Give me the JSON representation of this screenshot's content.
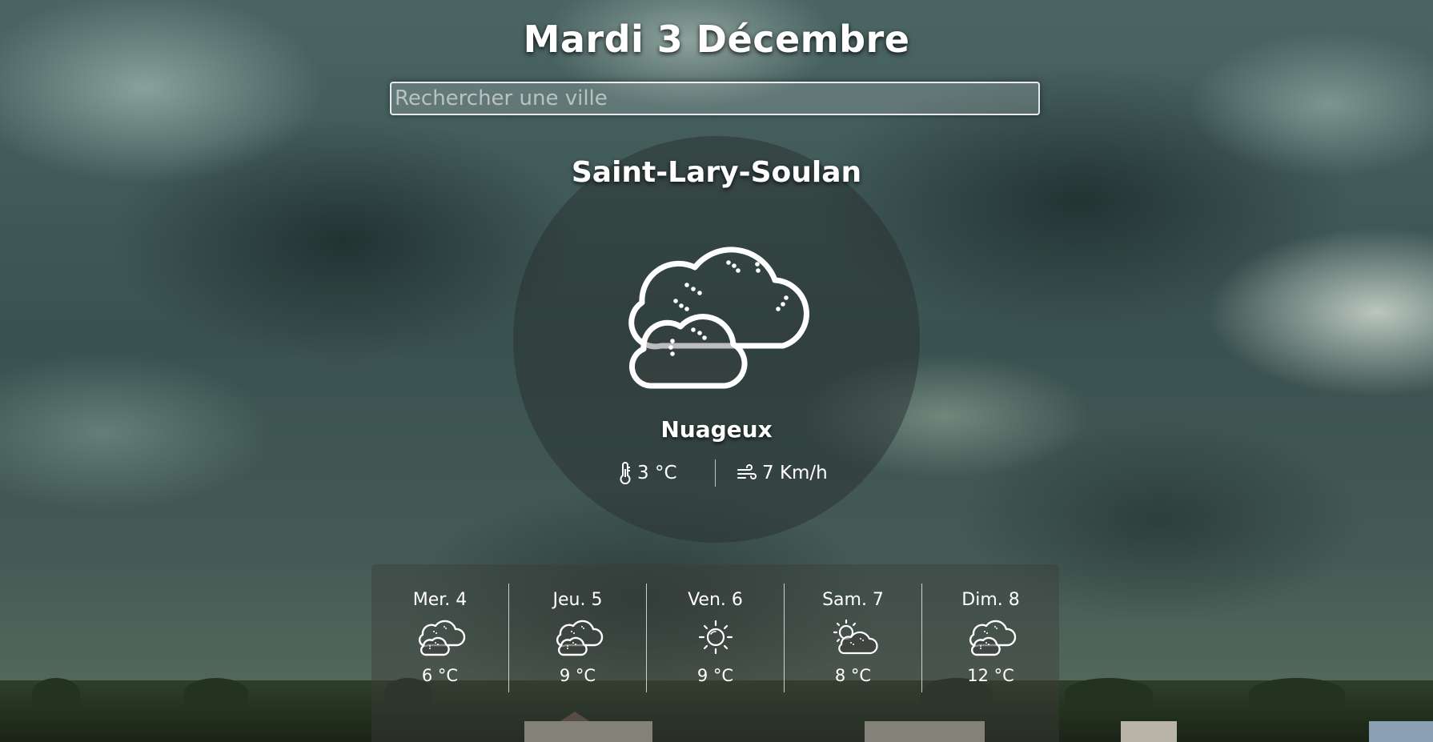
{
  "header": {
    "date": "Mardi 3 Décembre"
  },
  "search": {
    "placeholder": "Rechercher une ville",
    "value": ""
  },
  "current": {
    "city": "Saint-Lary-Soulan",
    "condition": "Nuageux",
    "icon": "cloudy-icon",
    "temperature": "3 °C",
    "temperature_icon": "thermometer-icon",
    "wind": "7 Km/h",
    "wind_icon": "wind-icon"
  },
  "forecast": [
    {
      "day": "Mer. 4",
      "icon": "cloudy-icon",
      "temp": "6 °C"
    },
    {
      "day": "Jeu. 5",
      "icon": "cloudy-icon",
      "temp": "9 °C"
    },
    {
      "day": "Ven. 6",
      "icon": "sun-icon",
      "temp": "9 °C"
    },
    {
      "day": "Sam. 7",
      "icon": "partly-cloudy-icon",
      "temp": "8 °C"
    },
    {
      "day": "Dim. 8",
      "icon": "cloudy-icon",
      "temp": "12 °C"
    }
  ]
}
